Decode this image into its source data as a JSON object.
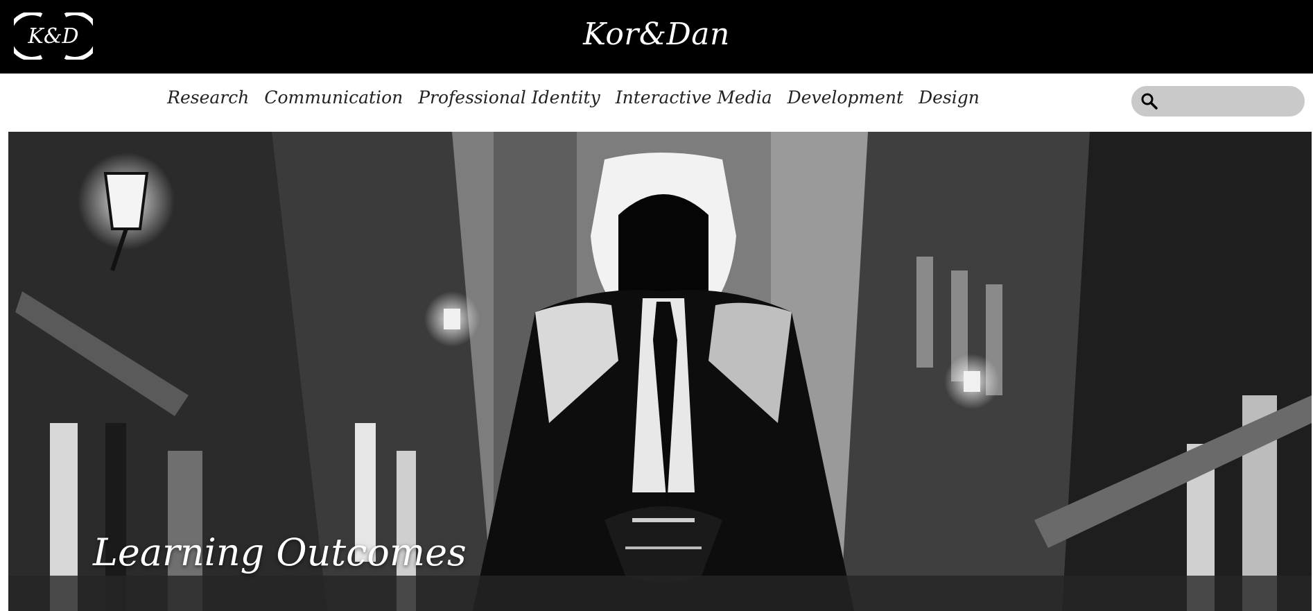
{
  "header": {
    "logo_text": "K&D",
    "site_title": "Kor&Dan"
  },
  "nav": {
    "items": [
      {
        "label": "Research"
      },
      {
        "label": "Communication"
      },
      {
        "label": "Professional Identity"
      },
      {
        "label": "Interactive Media"
      },
      {
        "label": "Development"
      },
      {
        "label": "Design"
      }
    ]
  },
  "search": {
    "icon": "search-icon",
    "placeholder": ""
  },
  "hero": {
    "title": "Learning Outcomes",
    "image": "noir-hooded-figure-in-suit-on-street-illustration"
  },
  "colors": {
    "header_bg": "#000000",
    "nav_bg": "#ffffff",
    "search_bg": "#c9c9c9"
  }
}
